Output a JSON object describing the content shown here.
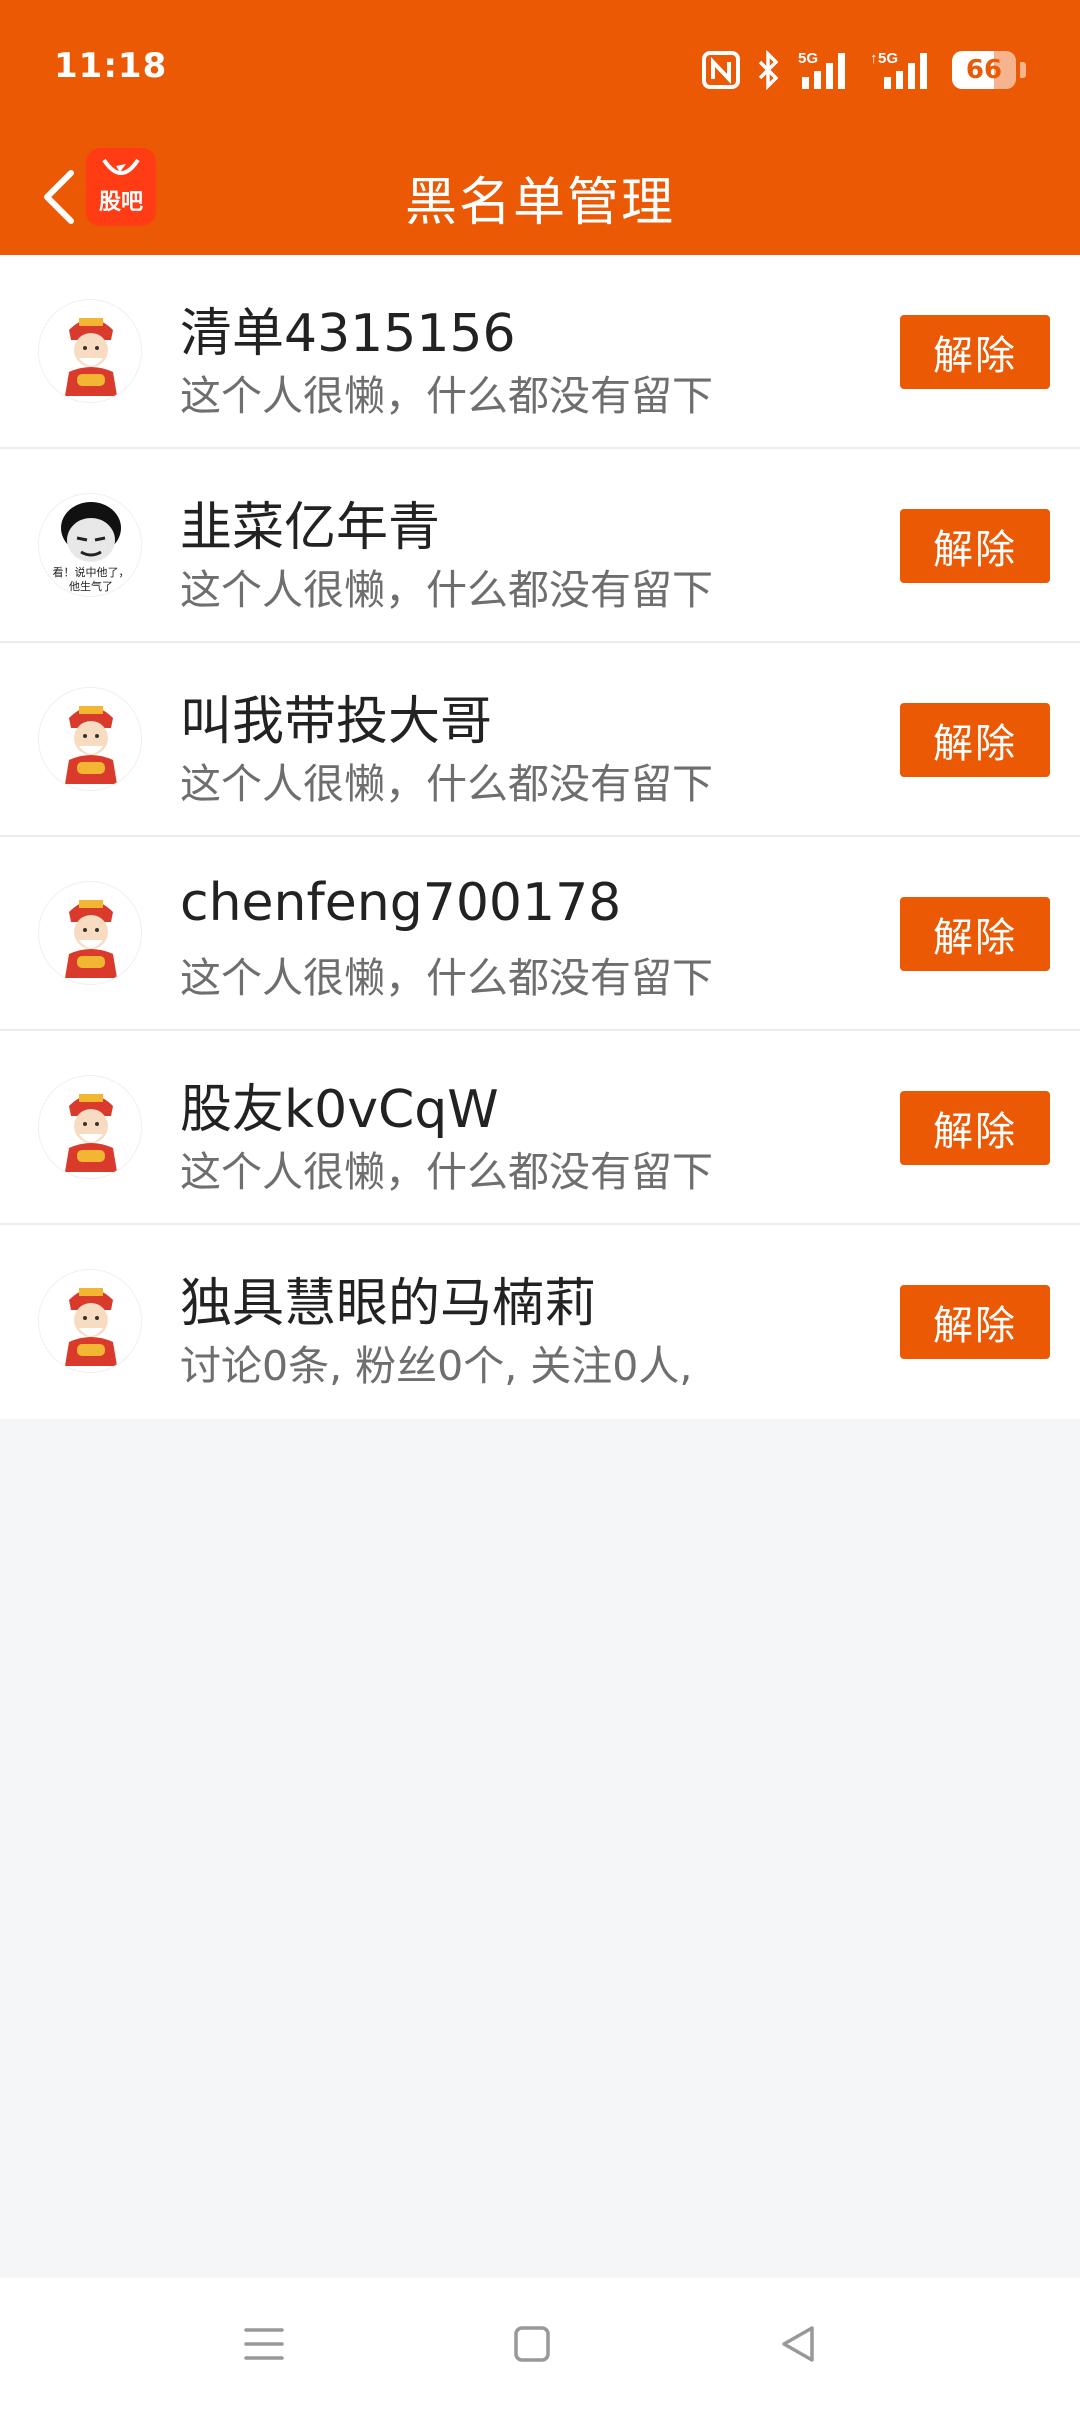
{
  "status_bar": {
    "time": "11:18",
    "battery_level": "66",
    "battery_fraction": 0.66,
    "network_1": "5G",
    "network_2": "5G",
    "icons": [
      "nfc-icon",
      "bluetooth-icon",
      "signal-5g-icon",
      "signal-5g-icon",
      "battery-icon"
    ]
  },
  "nav": {
    "back_icon": "chevron-left-icon",
    "app_logo_text": "股吧",
    "title": "黑名单管理"
  },
  "colors": {
    "brand": "#eb5905",
    "background": "#f5f6f8"
  },
  "blacklist": [
    {
      "name": "清单4315156",
      "desc": "这个人很懒，什么都没有留下",
      "action": "解除",
      "avatar": "fortune-god-avatar"
    },
    {
      "name": "韭菜亿年青",
      "desc": "这个人很懒，什么都没有留下",
      "action": "解除",
      "avatar": "meme-face-avatar"
    },
    {
      "name": "叫我带投大哥",
      "desc": "这个人很懒，什么都没有留下",
      "action": "解除",
      "avatar": "fortune-god-avatar"
    },
    {
      "name": "chenfeng700178",
      "desc": "这个人很懒，什么都没有留下",
      "action": "解除",
      "avatar": "fortune-god-avatar"
    },
    {
      "name": "股友k0vCqW",
      "desc": "这个人很懒，什么都没有留下",
      "action": "解除",
      "avatar": "fortune-god-avatar"
    },
    {
      "name": "独具慧眼的马楠莉",
      "desc": "讨论0条, 粉丝0个, 关注0人,",
      "action": "解除",
      "avatar": "fortune-god-avatar"
    }
  ],
  "meme_caption_1": "看！说中他了，",
  "meme_caption_2": "他生气了",
  "system_nav": {
    "icons": [
      "menu-icon",
      "home-square-icon",
      "back-triangle-icon"
    ]
  }
}
